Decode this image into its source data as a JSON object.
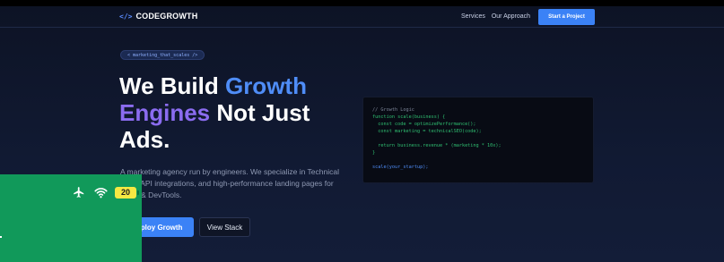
{
  "nav": {
    "logo_icon": "</>",
    "logo_text": "CODEGROWTH",
    "links": [
      "Services",
      "Our Approach"
    ],
    "cta_label": "Start a Project"
  },
  "hero": {
    "badge_text": "< marketing_that_scales />",
    "headline": {
      "part1": "We Build ",
      "part2": "Growth",
      "part3": "Engines",
      "part4": " Not Just",
      "part5": "Ads."
    },
    "description": "A marketing agency run by engineers. We specialize in Technical SEO, API integrations, and high-performance landing pages for SaaS & DevTools.",
    "primary_button": "Deploy Growth",
    "secondary_button": "View Stack"
  },
  "code_block": {
    "lines": [
      "// Growth Logic",
      "function scale(business) {",
      "  const code = optimizePerformance();",
      "  const marketing = technicalSEO(code);",
      "",
      "  return business.revenue * (marketing * 10x);",
      "}",
      "",
      "scale(your_startup);"
    ]
  },
  "status_overlay": {
    "icons": [
      "airplane-icon",
      "wifi-icon",
      "battery-icon"
    ],
    "battery_level": "20"
  },
  "colors": {
    "accent": "#3b82f6",
    "headline_blue": "#4f8df7",
    "headline_purple": "#8b6cf0",
    "code_green": "#2fbf71",
    "overlay_green": "#11995a",
    "battery_yellow": "#f4e843"
  }
}
